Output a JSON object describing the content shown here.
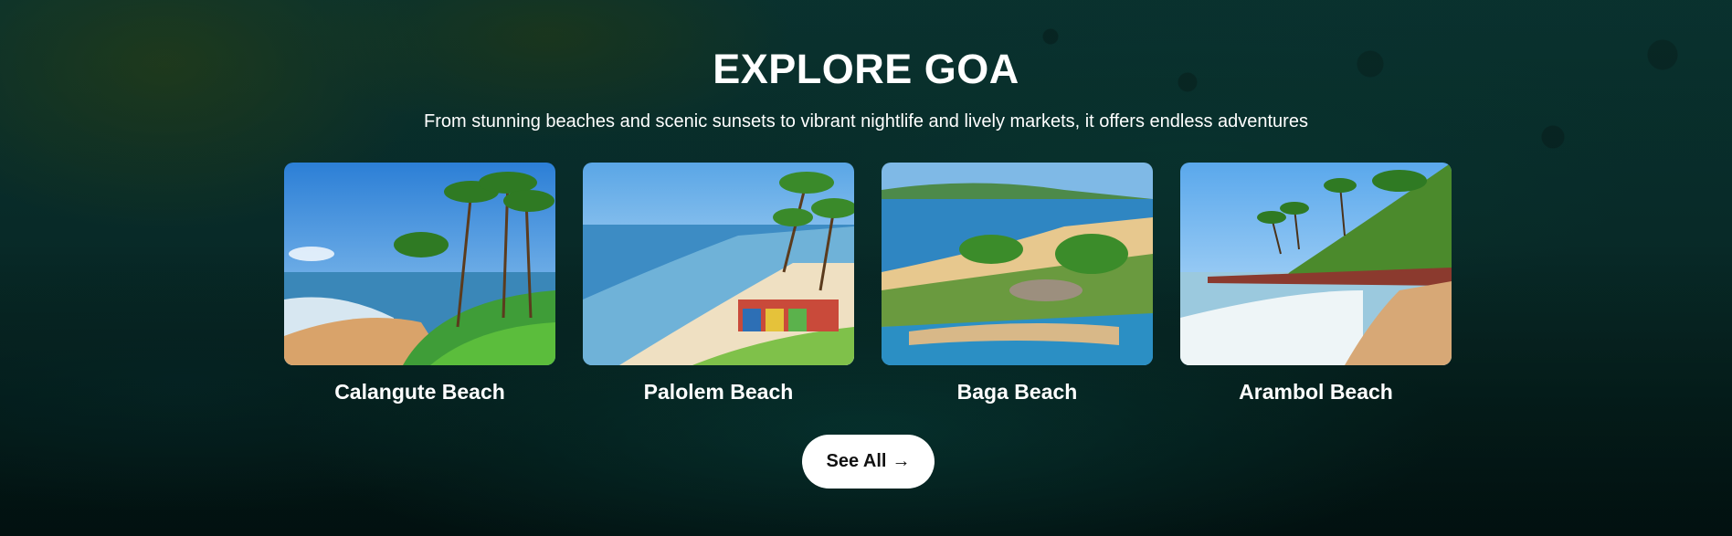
{
  "section": {
    "title": "EXPLORE GOA",
    "subtitle": "From stunning beaches and scenic sunsets to vibrant nightlife and lively markets, it offers endless adventures"
  },
  "destinations": [
    {
      "name": "Calangute Beach"
    },
    {
      "name": "Palolem Beach"
    },
    {
      "name": "Baga Beach"
    },
    {
      "name": "Arambol Beach"
    }
  ],
  "cta": {
    "label": "See All",
    "arrow": "→",
    "icon": "arrow-right-icon"
  },
  "colors": {
    "background": "#0a3431",
    "text": "#ffffff",
    "button_bg": "#ffffff",
    "button_text": "#111111"
  }
}
